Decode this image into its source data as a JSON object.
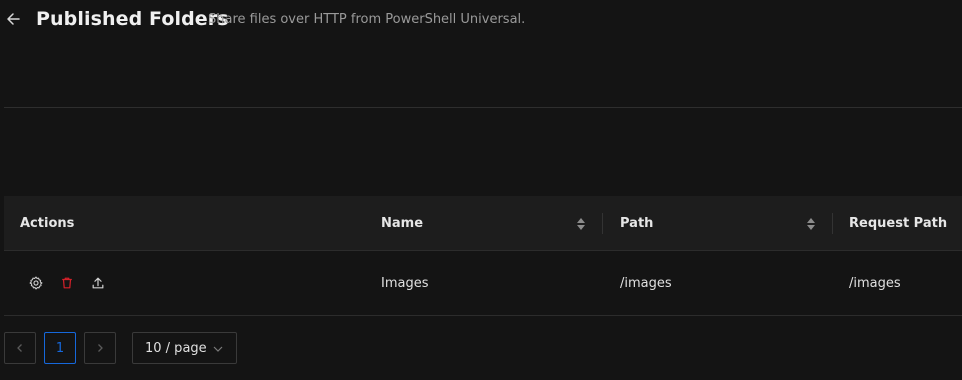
{
  "header": {
    "title": "Published Folders",
    "subtitle": "Share files over HTTP from PowerShell Universal.",
    "back_icon": "arrow-left-icon"
  },
  "table": {
    "columns": [
      "Actions",
      "Name",
      "Path",
      "Request Path"
    ],
    "rows": [
      {
        "name": "Images",
        "path": "/images",
        "request_path": "/images",
        "actions": [
          "settings-icon",
          "delete-icon",
          "upload-icon"
        ]
      }
    ]
  },
  "pagination": {
    "current_page": "1",
    "page_size": "10 / page"
  },
  "colors": {
    "background": "#141414",
    "header_row": "#1d1d1d",
    "accent": "#1668dc",
    "delete": "#d32029"
  }
}
